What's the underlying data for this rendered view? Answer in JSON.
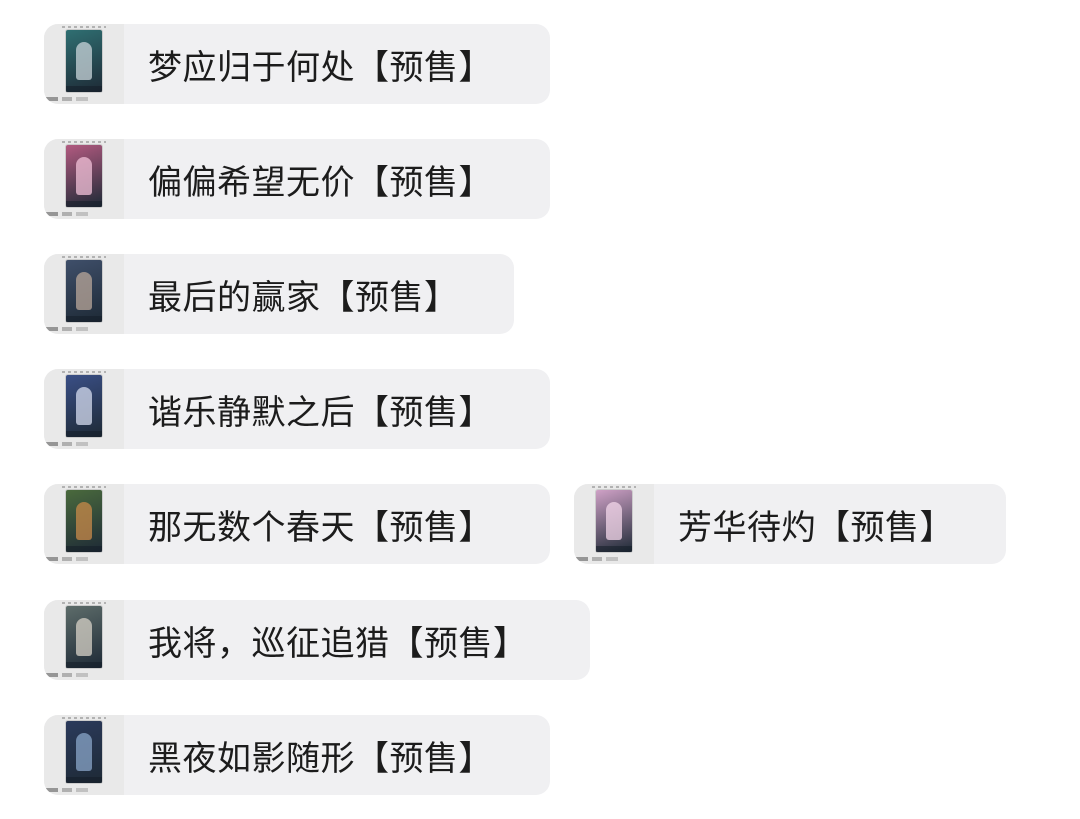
{
  "items": [
    {
      "title": "梦应归于何处【预售】",
      "thumb_color": "#2f6f72",
      "figure_color": "#c9d4da"
    },
    {
      "title": "偏偏希望无价【预售】",
      "thumb_color": "#b25a80",
      "figure_color": "#f2c2d8"
    },
    {
      "title": "最后的赢家【预售】",
      "thumb_color": "#3f4f6a",
      "figure_color": "#b9a79a"
    },
    {
      "title": "谐乐静默之后【预售】",
      "thumb_color": "#3a4f86",
      "figure_color": "#d6dcef"
    },
    {
      "title": "那无数个春天【预售】",
      "thumb_color": "#4a6a3d",
      "figure_color": "#c98a4a"
    },
    {
      "title": "芳华待灼【预售】",
      "thumb_color": "#cfa1c6",
      "figure_color": "#f3d7ea"
    },
    {
      "title": "我将，巡征追猎【预售】",
      "thumb_color": "#5d6c6a",
      "figure_color": "#d7d1c7"
    },
    {
      "title": "黑夜如影随形【预售】",
      "thumb_color": "#2b3a5b",
      "figure_color": "#8aa6c8"
    }
  ]
}
